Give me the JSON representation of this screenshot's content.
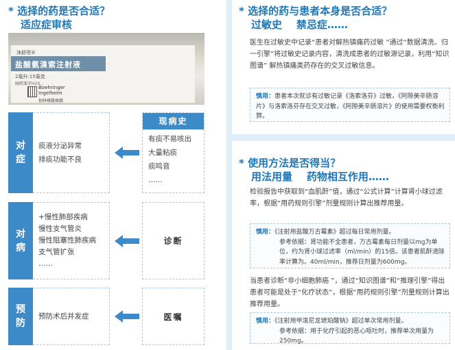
{
  "left": {
    "title_line1": "* 选择的药是否合适？",
    "title_line2": "适应症审核",
    "photo": {
      "brand": "沐舒坦®",
      "drug_name": "盐酸氨溴索注射液",
      "spec": "2毫升:15毫克",
      "approval": "国药准字H20…",
      "maker_line1": "Boehringer",
      "maker_line2": "Ingelheim",
      "maker_cn": "勃林格殷格翰"
    },
    "rows": [
      {
        "tag": [
          "对",
          "症"
        ],
        "items": [
          "痰液分泌异常",
          "排痰功能不良"
        ]
      },
      {
        "tag": [
          "对",
          "病"
        ],
        "items": [
          "+慢性肺部疾病",
          "慢性支气管炎",
          "慢性阻塞性肺疾病",
          "支气管扩张",
          "……"
        ]
      },
      {
        "tag": [
          "预",
          "防"
        ],
        "items": [
          "预防术后并发症"
        ]
      }
    ],
    "history": {
      "header": "现病史",
      "items": [
        "有痰不易咳出",
        "大量粘痰",
        "痰鸣音",
        "……"
      ]
    },
    "diagnosis": "诊断",
    "doctor_order": "医嘱"
  },
  "right_top": {
    "title_line1": "* 选择的药与患者本身是否合适？",
    "title_line2": "过敏史    禁忌症……",
    "paragraph": "医生在过敏史中记录“患者对解热镇痛药过敏  ”通过“数据清洗、归一引擎”将过敏史记录内容，清洗成患者的过敏源记录，利用“知识图谱”  解热镇痛类药存在的交叉过敏信息。",
    "hint_label": "慎用：",
    "hint_text": "患者本次就诊有过敏记录《洛索洛芬》过敏，《阿隙美辛肠溶片》与洛索洛芬存在交叉过敏，《阿隙美辛肠溶片》的使用需要权衡利弊。"
  },
  "right_bottom": {
    "title_line1": "* 使用方法是否得当？",
    "title_line2": "用法用量    药物相互作用……",
    "paragraph1": "检验报告中获取到“血肌酐”值，通过“公式计算”计算肾小球过滤率，根据“用药规则引擎”剂量规则计算出推荐用量。",
    "hint1_label": "慎用：",
    "hint1_line1": "《注射用盐酸万古霉素》超过每日常用剂量。",
    "hint1_line2": "参考依据：肾功能不全患者，万古霉素每日剂量以mg为单位，约为肾小球过滤率（ml/min）的15倍。该患者肌酐清除率计算为。40ml/min，推荐日剂量为600mg。",
    "paragraph2": "当患者诊断“非小细胞肺癌  ”，通过“知识图谱”和“推理引擎”得出患者可能是处于“化疗状态”，根据“用药规则引擎”剂量规则计算出推荐用量。",
    "hint2_label": "慎用：",
    "hint2_line1": "《注射用甲泼尼龙琥珀酸钠》超过单次常用剂量。",
    "hint2_line2": "参考依据：用于化疗引起的恶心呕吐时，推荐单次用量为250mg。"
  }
}
